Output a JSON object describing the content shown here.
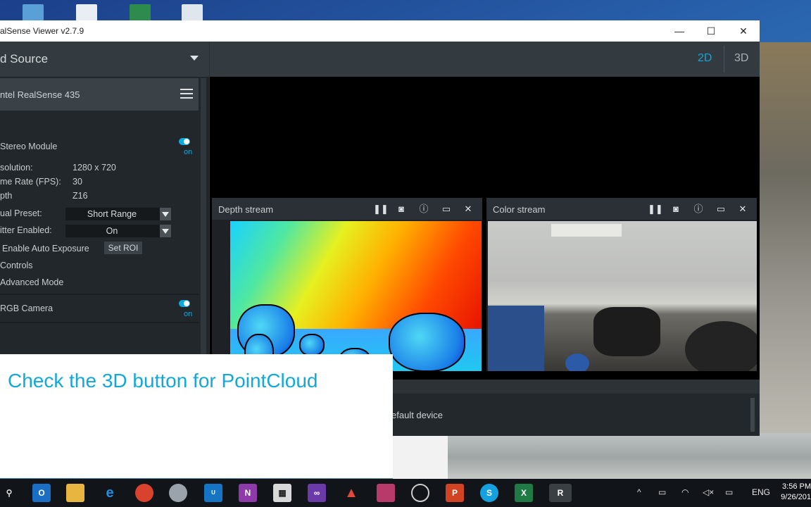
{
  "window": {
    "title": "alSense Viewer v2.7.9",
    "minimize_glyph": "—",
    "maximize_glyph": "☐",
    "close_glyph": "✕"
  },
  "sidebar": {
    "source_label": "d Source",
    "device_name": "ntel RealSense 435",
    "stereo_module": "Stereo Module",
    "stereo_toggle": "on",
    "settings": [
      {
        "label": "solution:",
        "value": "1280 x 720"
      },
      {
        "label": "me Rate (FPS):",
        "value": "30"
      },
      {
        "label": "pth",
        "value": "Z16"
      }
    ],
    "visual_preset_label": "ual Preset:",
    "visual_preset_value": "Short Range",
    "emitter_label": "itter Enabled:",
    "emitter_value": "On",
    "auto_exposure_label": "Enable Auto Exposure",
    "set_roi_label": "Set ROI",
    "controls_label": "Controls",
    "advanced_mode_label": "Advanced Mode",
    "rgb_camera": "RGB Camera",
    "rgb_toggle": "on"
  },
  "view_modes": {
    "mode_2d": "2D",
    "mode_3d": "3D",
    "active": "2D"
  },
  "streams": [
    {
      "title": "Depth stream"
    },
    {
      "title": "Color stream"
    }
  ],
  "stream_icons": [
    "pause-icon",
    "camera-icon",
    "info-icon",
    "maximize-icon",
    "close-icon"
  ],
  "log": {
    "text": "efault device"
  },
  "overlay": {
    "caption": "Check the 3D button for PointCloud"
  },
  "taskbar": {
    "tray_lang": "ENG",
    "time": "3:56 PM",
    "date": "9/26/201"
  },
  "colors": {
    "accent": "#0fa8dc",
    "panel": "#22272b",
    "header": "#333a40"
  }
}
